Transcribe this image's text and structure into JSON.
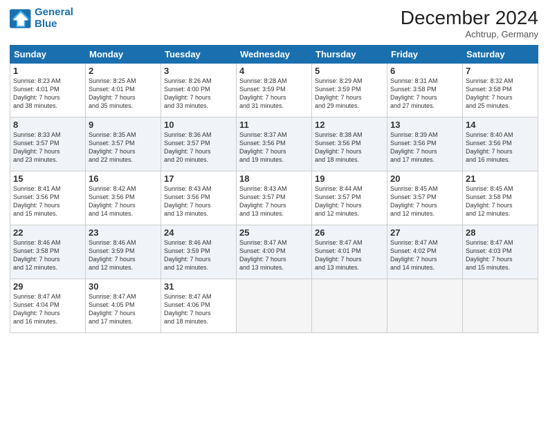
{
  "header": {
    "logo_line1": "General",
    "logo_line2": "Blue",
    "month": "December 2024",
    "location": "Achtrup, Germany"
  },
  "weekdays": [
    "Sunday",
    "Monday",
    "Tuesday",
    "Wednesday",
    "Thursday",
    "Friday",
    "Saturday"
  ],
  "weeks": [
    [
      {
        "day": "1",
        "lines": [
          "Sunrise: 8:23 AM",
          "Sunset: 4:01 PM",
          "Daylight: 7 hours",
          "and 38 minutes."
        ]
      },
      {
        "day": "2",
        "lines": [
          "Sunrise: 8:25 AM",
          "Sunset: 4:01 PM",
          "Daylight: 7 hours",
          "and 35 minutes."
        ]
      },
      {
        "day": "3",
        "lines": [
          "Sunrise: 8:26 AM",
          "Sunset: 4:00 PM",
          "Daylight: 7 hours",
          "and 33 minutes."
        ]
      },
      {
        "day": "4",
        "lines": [
          "Sunrise: 8:28 AM",
          "Sunset: 3:59 PM",
          "Daylight: 7 hours",
          "and 31 minutes."
        ]
      },
      {
        "day": "5",
        "lines": [
          "Sunrise: 8:29 AM",
          "Sunset: 3:59 PM",
          "Daylight: 7 hours",
          "and 29 minutes."
        ]
      },
      {
        "day": "6",
        "lines": [
          "Sunrise: 8:31 AM",
          "Sunset: 3:58 PM",
          "Daylight: 7 hours",
          "and 27 minutes."
        ]
      },
      {
        "day": "7",
        "lines": [
          "Sunrise: 8:32 AM",
          "Sunset: 3:58 PM",
          "Daylight: 7 hours",
          "and 25 minutes."
        ]
      }
    ],
    [
      {
        "day": "8",
        "lines": [
          "Sunrise: 8:33 AM",
          "Sunset: 3:57 PM",
          "Daylight: 7 hours",
          "and 23 minutes."
        ]
      },
      {
        "day": "9",
        "lines": [
          "Sunrise: 8:35 AM",
          "Sunset: 3:57 PM",
          "Daylight: 7 hours",
          "and 22 minutes."
        ]
      },
      {
        "day": "10",
        "lines": [
          "Sunrise: 8:36 AM",
          "Sunset: 3:57 PM",
          "Daylight: 7 hours",
          "and 20 minutes."
        ]
      },
      {
        "day": "11",
        "lines": [
          "Sunrise: 8:37 AM",
          "Sunset: 3:56 PM",
          "Daylight: 7 hours",
          "and 19 minutes."
        ]
      },
      {
        "day": "12",
        "lines": [
          "Sunrise: 8:38 AM",
          "Sunset: 3:56 PM",
          "Daylight: 7 hours",
          "and 18 minutes."
        ]
      },
      {
        "day": "13",
        "lines": [
          "Sunrise: 8:39 AM",
          "Sunset: 3:56 PM",
          "Daylight: 7 hours",
          "and 17 minutes."
        ]
      },
      {
        "day": "14",
        "lines": [
          "Sunrise: 8:40 AM",
          "Sunset: 3:56 PM",
          "Daylight: 7 hours",
          "and 16 minutes."
        ]
      }
    ],
    [
      {
        "day": "15",
        "lines": [
          "Sunrise: 8:41 AM",
          "Sunset: 3:56 PM",
          "Daylight: 7 hours",
          "and 15 minutes."
        ]
      },
      {
        "day": "16",
        "lines": [
          "Sunrise: 8:42 AM",
          "Sunset: 3:56 PM",
          "Daylight: 7 hours",
          "and 14 minutes."
        ]
      },
      {
        "day": "17",
        "lines": [
          "Sunrise: 8:43 AM",
          "Sunset: 3:56 PM",
          "Daylight: 7 hours",
          "and 13 minutes."
        ]
      },
      {
        "day": "18",
        "lines": [
          "Sunrise: 8:43 AM",
          "Sunset: 3:57 PM",
          "Daylight: 7 hours",
          "and 13 minutes."
        ]
      },
      {
        "day": "19",
        "lines": [
          "Sunrise: 8:44 AM",
          "Sunset: 3:57 PM",
          "Daylight: 7 hours",
          "and 12 minutes."
        ]
      },
      {
        "day": "20",
        "lines": [
          "Sunrise: 8:45 AM",
          "Sunset: 3:57 PM",
          "Daylight: 7 hours",
          "and 12 minutes."
        ]
      },
      {
        "day": "21",
        "lines": [
          "Sunrise: 8:45 AM",
          "Sunset: 3:58 PM",
          "Daylight: 7 hours",
          "and 12 minutes."
        ]
      }
    ],
    [
      {
        "day": "22",
        "lines": [
          "Sunrise: 8:46 AM",
          "Sunset: 3:58 PM",
          "Daylight: 7 hours",
          "and 12 minutes."
        ]
      },
      {
        "day": "23",
        "lines": [
          "Sunrise: 8:46 AM",
          "Sunset: 3:59 PM",
          "Daylight: 7 hours",
          "and 12 minutes."
        ]
      },
      {
        "day": "24",
        "lines": [
          "Sunrise: 8:46 AM",
          "Sunset: 3:59 PM",
          "Daylight: 7 hours",
          "and 12 minutes."
        ]
      },
      {
        "day": "25",
        "lines": [
          "Sunrise: 8:47 AM",
          "Sunset: 4:00 PM",
          "Daylight: 7 hours",
          "and 13 minutes."
        ]
      },
      {
        "day": "26",
        "lines": [
          "Sunrise: 8:47 AM",
          "Sunset: 4:01 PM",
          "Daylight: 7 hours",
          "and 13 minutes."
        ]
      },
      {
        "day": "27",
        "lines": [
          "Sunrise: 8:47 AM",
          "Sunset: 4:02 PM",
          "Daylight: 7 hours",
          "and 14 minutes."
        ]
      },
      {
        "day": "28",
        "lines": [
          "Sunrise: 8:47 AM",
          "Sunset: 4:03 PM",
          "Daylight: 7 hours",
          "and 15 minutes."
        ]
      }
    ],
    [
      {
        "day": "29",
        "lines": [
          "Sunrise: 8:47 AM",
          "Sunset: 4:04 PM",
          "Daylight: 7 hours",
          "and 16 minutes."
        ]
      },
      {
        "day": "30",
        "lines": [
          "Sunrise: 8:47 AM",
          "Sunset: 4:05 PM",
          "Daylight: 7 hours",
          "and 17 minutes."
        ]
      },
      {
        "day": "31",
        "lines": [
          "Sunrise: 8:47 AM",
          "Sunset: 4:06 PM",
          "Daylight: 7 hours",
          "and 18 minutes."
        ]
      },
      null,
      null,
      null,
      null
    ]
  ]
}
